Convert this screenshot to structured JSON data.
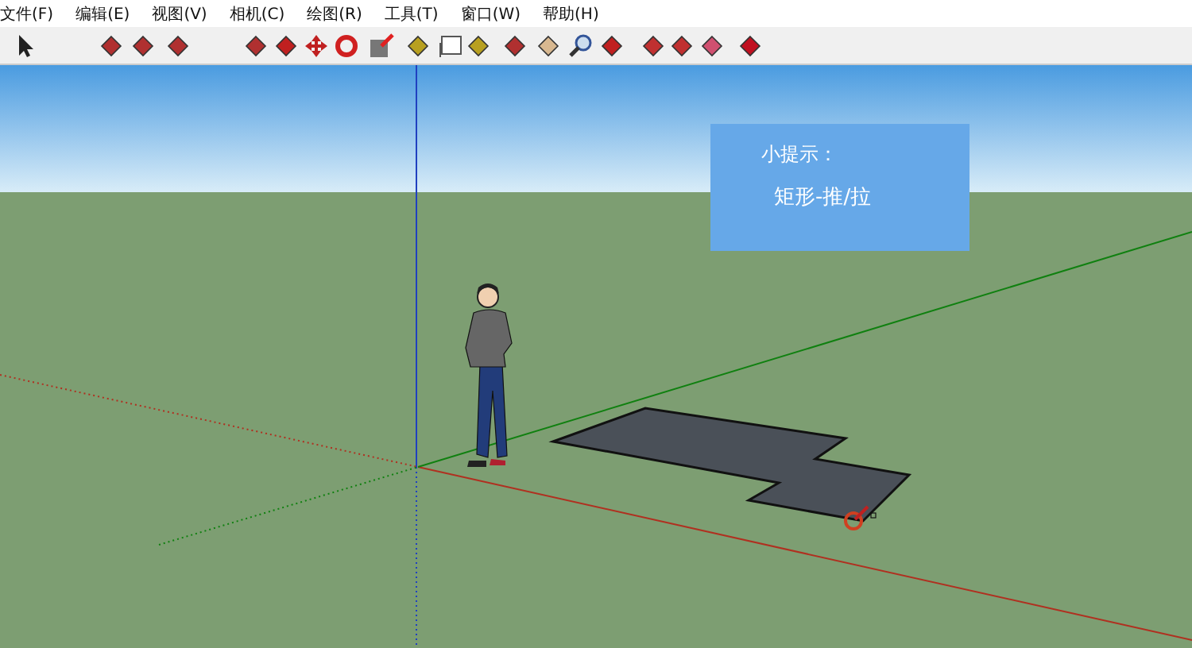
{
  "menu_bar": {
    "items": [
      {
        "label": "文件(F)"
      },
      {
        "label": "编辑(E)"
      },
      {
        "label": "视图(V)"
      },
      {
        "label": "相机(C)"
      },
      {
        "label": "绘图(R)"
      },
      {
        "label": "工具(T)"
      },
      {
        "label": "窗口(W)"
      },
      {
        "label": "帮助(H)"
      }
    ]
  },
  "hint_box": {
    "title": "小提示：",
    "text": "矩形-推/拉"
  }
}
